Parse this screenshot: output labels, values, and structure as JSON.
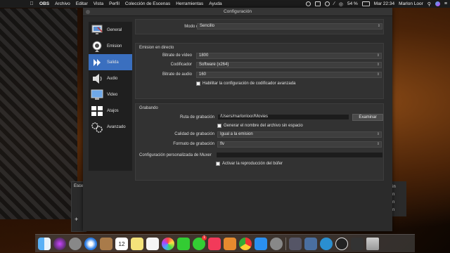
{
  "menubar": {
    "app": "OBS",
    "items": [
      "Archivo",
      "Editar",
      "Vista",
      "Perfil",
      "Colección de Escenas",
      "Herramientas",
      "Ayuda"
    ],
    "battery": "54 %",
    "clock": "Mar 22:34",
    "user": "Marlon Loor"
  },
  "window": {
    "title": "Configuración"
  },
  "sidebar": {
    "items": [
      {
        "label": "General",
        "icon": "monitor-icon"
      },
      {
        "label": "Emision",
        "icon": "broadcast-icon"
      },
      {
        "label": "Salida",
        "icon": "output-icon",
        "active": true
      },
      {
        "label": "Audio",
        "icon": "speaker-icon"
      },
      {
        "label": "Video",
        "icon": "display-icon"
      },
      {
        "label": "Atajos",
        "icon": "keyboard-icon"
      },
      {
        "label": "Avanzado",
        "icon": "gears-icon"
      }
    ]
  },
  "output": {
    "mode_label": "Modo de salida",
    "mode_value": "Sencillo",
    "streaming": {
      "title": "Emision en directo",
      "video_bitrate_label": "Bitrate de vídeo",
      "video_bitrate_value": "1800",
      "encoder_label": "Codificador",
      "encoder_value": "Software (x264)",
      "audio_bitrate_label": "Bitrate de audio",
      "audio_bitrate_value": "160",
      "advanced_checkbox": "Habilitar la configuración de codificador avanzada"
    },
    "recording": {
      "title": "Grabando",
      "path_label": "Ruta de grabación",
      "path_value": "/Users/marlonloor/Movies",
      "browse_button": "Examinar",
      "no_space_checkbox": "Generar el nombre del archivo sin espacio",
      "quality_label": "Calidad de grabación",
      "quality_value": "Igual a la emision",
      "format_label": "Formato de grabación",
      "format_value": "flv",
      "muxer_label": "Configuración personalizada de Muxer",
      "muxer_value": "",
      "buffer_checkbox": "Activar la reproducción del búfer"
    }
  },
  "obs_background": {
    "scenes_label": "Esce",
    "add_symbol": "+",
    "right_labels": [
      "in",
      "n",
      "n",
      "n"
    ]
  },
  "dock": {
    "calendar_day": "12",
    "badge": "1"
  }
}
